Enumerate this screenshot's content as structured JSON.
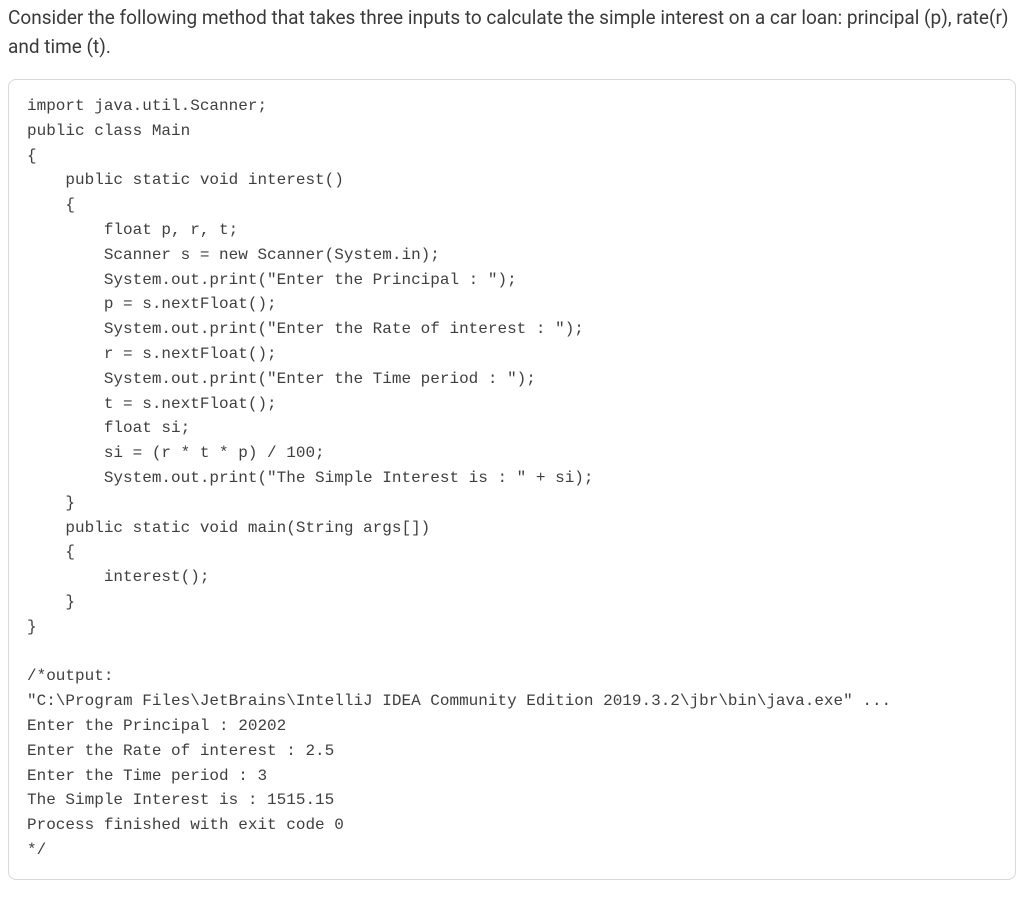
{
  "intro": "Consider the following method that takes three inputs to calculate the simple interest on a car loan: principal (p), rate(r) and time (t).",
  "code": {
    "l01": "import java.util.Scanner;",
    "l02": "public class Main",
    "l03": "{",
    "l04": "    public static void interest()",
    "l05": "    {",
    "l06": "        float p, r, t;",
    "l07": "        Scanner s = new Scanner(System.in);",
    "l08": "        System.out.print(\"Enter the Principal : \");",
    "l09": "        p = s.nextFloat();",
    "l10": "        System.out.print(\"Enter the Rate of interest : \");",
    "l11": "        r = s.nextFloat();",
    "l12": "        System.out.print(\"Enter the Time period : \");",
    "l13": "        t = s.nextFloat();",
    "l14": "        float si;",
    "l15": "        si = (r * t * p) / 100;",
    "l16": "        System.out.print(\"The Simple Interest is : \" + si);",
    "l17": "    }",
    "l18": "    public static void main(String args[])",
    "l19": "    {",
    "l20": "        interest();",
    "l21": "    }",
    "l22": "}",
    "l23": "",
    "l24": "/*output:",
    "l25": "\"C:\\Program Files\\JetBrains\\IntelliJ IDEA Community Edition 2019.3.2\\jbr\\bin\\java.exe\" ...",
    "l26": "Enter the Principal : 20202",
    "l27": "Enter the Rate of interest : 2.5",
    "l28": "Enter the Time period : 3",
    "l29": "The Simple Interest is : 1515.15",
    "l30": "Process finished with exit code 0",
    "l31": "*/"
  }
}
